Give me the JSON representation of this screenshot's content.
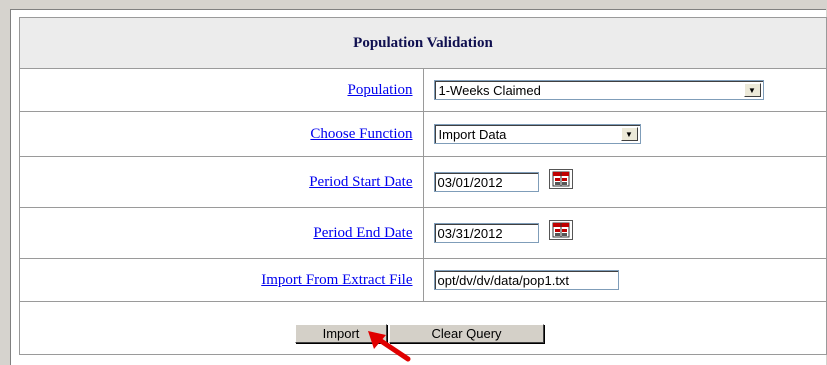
{
  "form": {
    "title": "Population Validation",
    "population": {
      "label": "Population",
      "value": "1-Weeks Claimed"
    },
    "choose_function": {
      "label": "Choose Function",
      "value": "Import Data"
    },
    "period_start": {
      "label": "Period Start Date",
      "value": "03/01/2012"
    },
    "period_end": {
      "label": "Period End Date",
      "value": "03/31/2012"
    },
    "import_file": {
      "label": "Import From Extract File",
      "value": "opt/dv/dv/data/pop1.txt"
    },
    "buttons": {
      "import_label": "Import",
      "clear_label": "Clear Query"
    }
  },
  "colors": {
    "link": "#0000ee",
    "header_text": "#101050",
    "arrow": "#e00000",
    "background": "#d6d3ce"
  },
  "icons": {
    "dropdown": "chevron-down-icon",
    "calendar": "calendar-icon",
    "pointer": "red-arrow-icon"
  }
}
